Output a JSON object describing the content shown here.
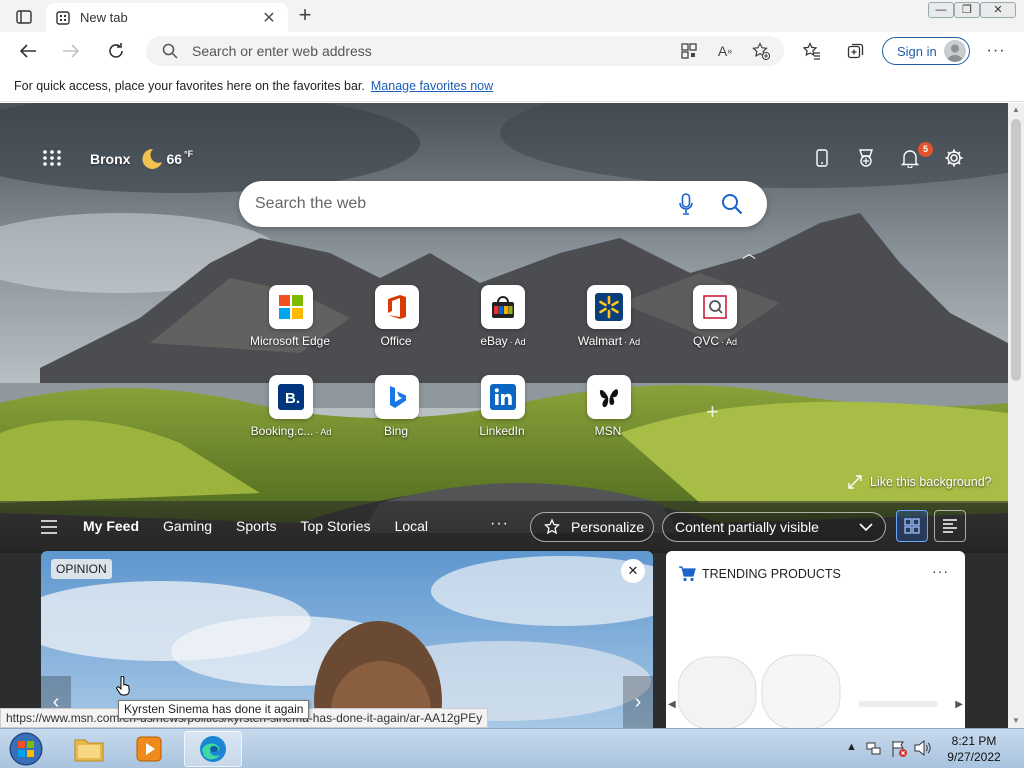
{
  "browser": {
    "tab_title": "New tab",
    "address_placeholder": "Search or enter web address",
    "sign_in_label": "Sign in",
    "favorites_message": "For quick access, place your favorites here on the favorites bar.",
    "favorites_link": "Manage favorites now"
  },
  "newtab": {
    "location": "Bronx",
    "temperature": "66",
    "temp_unit": "°F",
    "notification_count": "5",
    "search_placeholder": "Search the web",
    "tiles": [
      {
        "label": "Microsoft Edge",
        "ad": ""
      },
      {
        "label": "Office",
        "ad": ""
      },
      {
        "label": "eBay",
        "ad": "· Ad"
      },
      {
        "label": "Walmart",
        "ad": "· Ad"
      },
      {
        "label": "QVC",
        "ad": "· Ad"
      },
      {
        "label": "Booking.c...",
        "ad": "· Ad"
      },
      {
        "label": "Bing",
        "ad": ""
      },
      {
        "label": "LinkedIn",
        "ad": ""
      },
      {
        "label": "MSN",
        "ad": ""
      }
    ],
    "like_background": "Like this background?"
  },
  "feed": {
    "tabs": [
      "My Feed",
      "Gaming",
      "Sports",
      "Top Stories",
      "Local"
    ],
    "more": "···",
    "personalize": "Personalize",
    "content_visibility": "Content partially visible",
    "main_card_badge": "OPINION",
    "trending_title": "TRENDING PRODUCTS",
    "trending_more": "···"
  },
  "status": {
    "url": "https://www.msn.com/en-us/news/politics/kyrsten-sinema-has-done-it-again/ar-AA12gPEy",
    "tooltip": "Kyrsten Sinema has done it again"
  },
  "taskbar": {
    "time": "8:21 PM",
    "date": "9/27/2022"
  },
  "colors": {
    "accent": "#1f5ea8",
    "badge": "#e3532b",
    "taskbar": "#b7cde6"
  }
}
